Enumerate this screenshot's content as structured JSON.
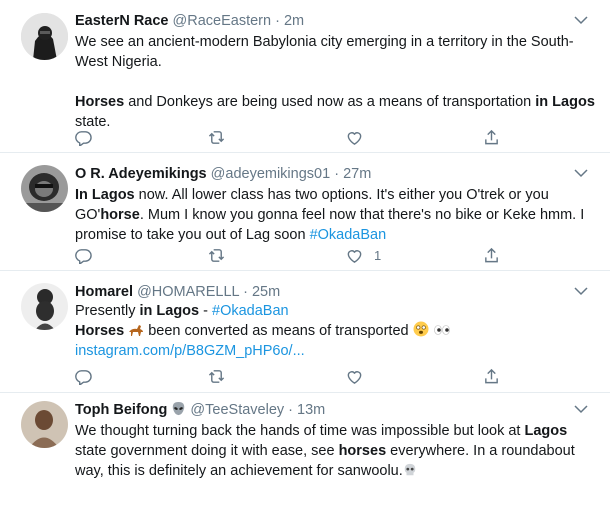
{
  "tweets": [
    {
      "name": "EasterN Race",
      "handle": "@RaceEastern",
      "time": "2m",
      "p1": "We see an ancient-modern Babylonia city emerging in a territory in the South-West Nigeria.",
      "p2a": "Horses",
      "p2b": " and Donkeys are being used now as a means of transportation ",
      "p2c": "in Lagos",
      "p2d": " state."
    },
    {
      "name": "O R. Adeyemikings",
      "handle": "@adeyemikings01",
      "time": "27m",
      "t1": "In Lagos",
      "t2": " now. All lower class has two options. It's either you O'trek or you GO'",
      "t3": "horse",
      "t4": ". Mum I know you gonna feel now that there's no bike or Keke hmm. I promise to take you out of Lag soon ",
      "hashtag": "#OkadaBan",
      "like_count": "1"
    },
    {
      "name": "Homarel",
      "handle": "@HOMARELLL",
      "time": "25m",
      "l1a": "Presently ",
      "l1b": "in Lagos",
      "l1c": " - ",
      "hashtag": "#OkadaBan",
      "l2a": "Horses",
      "l2b": " been converted as means of transported ",
      "url": "instagram.com/p/B8GZM_pHP6o/..."
    },
    {
      "name": "Toph Beifong",
      "handle": "@TeeStaveley",
      "time": "13m",
      "t1": "We thought turning back the hands of time was impossible but look at ",
      "t2": "Lagos",
      "t3": " state government doing it with ease, see ",
      "t4": "horses",
      "t5": " everywhere. In a roundabout way, this is definitely an achievement for sanwoolu."
    }
  ],
  "separator": " · ",
  "icons": {
    "reply": "reply-icon",
    "retweet": "retweet-icon",
    "like": "heart-icon",
    "share": "share-icon",
    "caret": "chevron-down-icon"
  },
  "colors": {
    "link": "#1b95e0",
    "muted": "#657786",
    "border": "#e6ecf0"
  }
}
